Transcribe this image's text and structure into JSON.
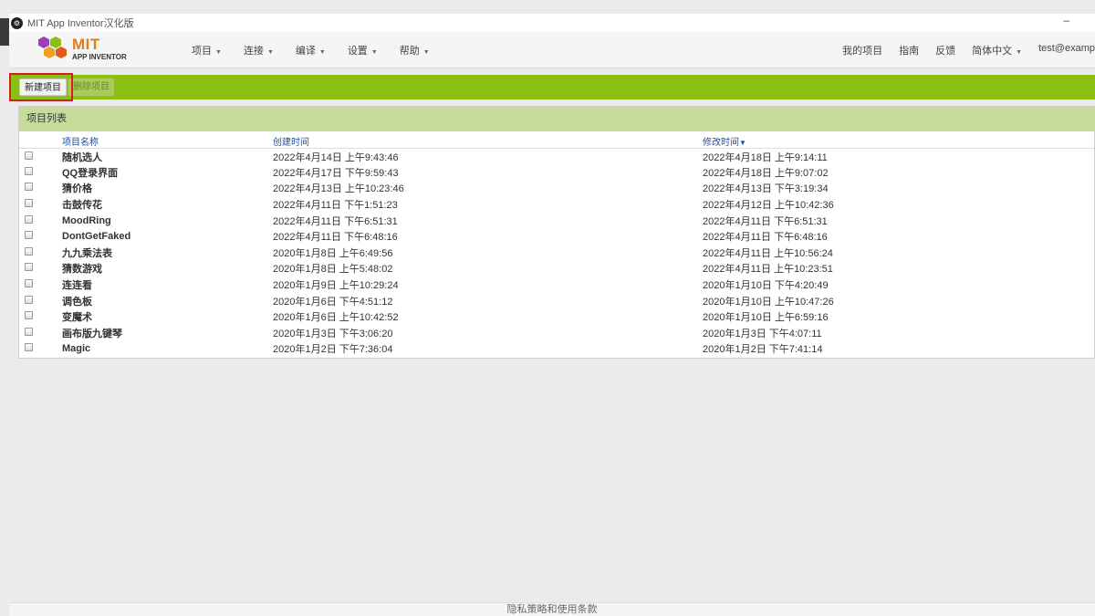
{
  "window": {
    "title": "MIT App Inventor汉化版",
    "minimize": "–"
  },
  "logo": {
    "mit": "MIT",
    "app_inventor": "APP INVENTOR"
  },
  "nav": [
    "项目",
    "连接",
    "编译",
    "设置",
    "帮助"
  ],
  "right_nav": {
    "my_projects": "我的项目",
    "guide": "指南",
    "feedback": "反馈",
    "language": "简体中文",
    "user": "test@examp"
  },
  "toolbar": {
    "new_project": "新建项目",
    "delete_project": "删除项目"
  },
  "panel": {
    "title": "项目列表"
  },
  "table": {
    "headers": {
      "name": "项目名称",
      "created": "创建时间",
      "modified": "修改时间",
      "sort_indicator": "▼"
    },
    "rows": [
      {
        "name": "随机选人",
        "created": "2022年4月14日 上午9:43:46",
        "modified": "2022年4月18日 上午9:14:11"
      },
      {
        "name": "QQ登录界面",
        "created": "2022年4月17日 下午9:59:43",
        "modified": "2022年4月18日 上午9:07:02"
      },
      {
        "name": "猜价格",
        "created": "2022年4月13日 上午10:23:46",
        "modified": "2022年4月13日 下午3:19:34"
      },
      {
        "name": "击鼓传花",
        "created": "2022年4月11日 下午1:51:23",
        "modified": "2022年4月12日 上午10:42:36"
      },
      {
        "name": "MoodRing",
        "created": "2022年4月11日 下午6:51:31",
        "modified": "2022年4月11日 下午6:51:31"
      },
      {
        "name": "DontGetFaked",
        "created": "2022年4月11日 下午6:48:16",
        "modified": "2022年4月11日 下午6:48:16"
      },
      {
        "name": "九九乘法表",
        "created": "2020年1月8日 上午6:49:56",
        "modified": "2022年4月11日 上午10:56:24"
      },
      {
        "name": "猜数游戏",
        "created": "2020年1月8日 上午5:48:02",
        "modified": "2022年4月11日 上午10:23:51"
      },
      {
        "name": "连连看",
        "created": "2020年1月9日 上午10:29:24",
        "modified": "2020年1月10日 下午4:20:49"
      },
      {
        "name": "调色板",
        "created": "2020年1月6日 下午4:51:12",
        "modified": "2020年1月10日 上午10:47:26"
      },
      {
        "name": "变魔术",
        "created": "2020年1月6日 上午10:42:52",
        "modified": "2020年1月10日 上午6:59:16"
      },
      {
        "name": "画布版九键琴",
        "created": "2020年1月3日 下午3:06:20",
        "modified": "2020年1月3日 下午4:07:11"
      },
      {
        "name": "Magic",
        "created": "2020年1月2日 下午7:36:04",
        "modified": "2020年1月2日 下午7:41:14"
      }
    ]
  },
  "footer": {
    "text": "隐私策略和使用条款"
  },
  "colors": {
    "toolbar_green": "#8cbf12",
    "panel_header": "#c5dc9a",
    "highlight_red": "#d21e1e",
    "logo_orange": "#e07b1c"
  }
}
